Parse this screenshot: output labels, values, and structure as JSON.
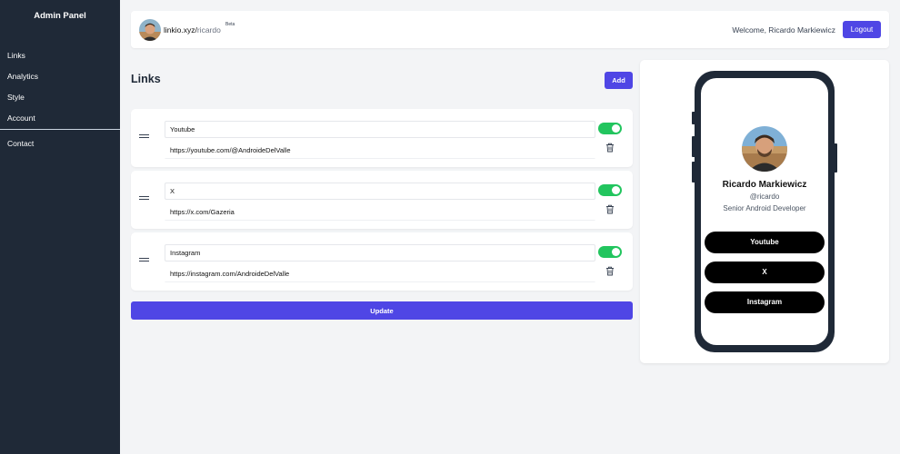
{
  "sidebar": {
    "title": "Admin Panel",
    "items": [
      {
        "label": "Links"
      },
      {
        "label": "Analytics"
      },
      {
        "label": "Style"
      },
      {
        "label": "Account"
      }
    ],
    "contact": "Contact"
  },
  "header": {
    "url_prefix": "linkio.xyz/",
    "username": "ricardo",
    "beta": "Beta",
    "welcome": "Welcome, Ricardo Markiewicz",
    "logout": "Logout"
  },
  "main": {
    "title": "Links",
    "add_label": "Add",
    "links": [
      {
        "title": "Youtube",
        "url": "https://youtube.com/@AndroideDelValle",
        "enabled": true
      },
      {
        "title": "X",
        "url": "https://x.com/Gazeria",
        "enabled": true
      },
      {
        "title": "Instagram",
        "url": "https://instagram.com/AndroideDelValle",
        "enabled": true
      }
    ],
    "update_label": "Update"
  },
  "preview": {
    "name": "Ricardo Markiewicz",
    "handle": "@ricardo",
    "bio": "Senior Android Developer",
    "links": [
      "Youtube",
      "X",
      "Instagram"
    ]
  },
  "colors": {
    "accent": "#4f46e5",
    "sidebar": "#1f2937",
    "toggle_on": "#22c55e"
  }
}
